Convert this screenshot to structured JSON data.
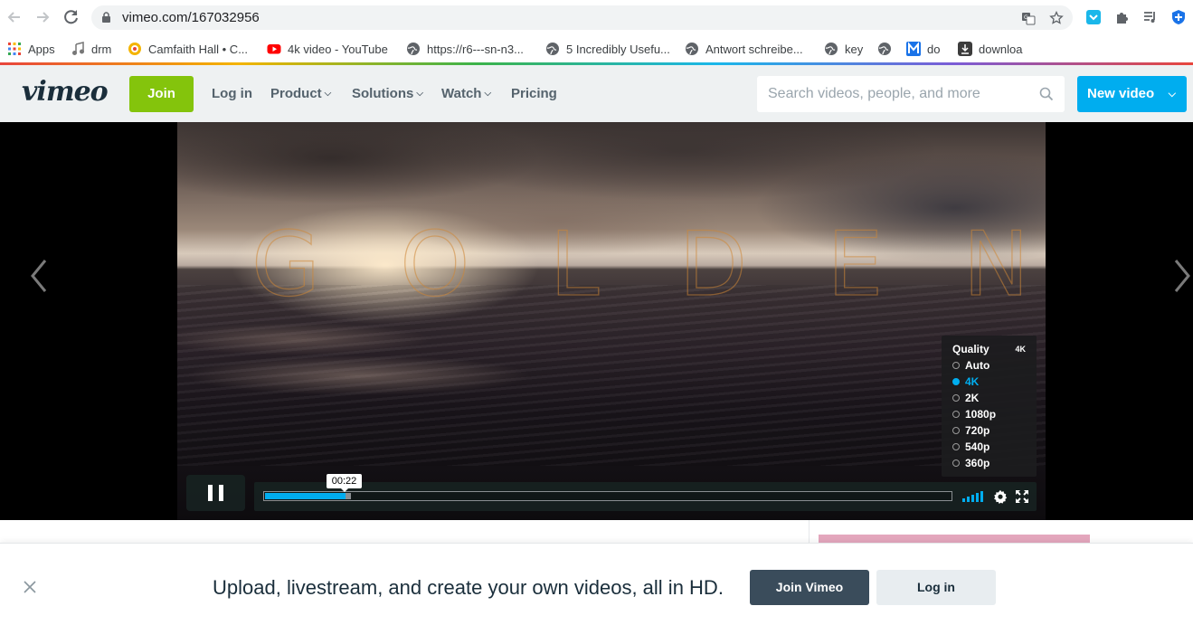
{
  "browser": {
    "url": "vimeo.com/167032956",
    "bookmarks": [
      {
        "label": "Apps",
        "icon": "apps-grid-icon"
      },
      {
        "label": "drm",
        "icon": "music-note-icon"
      },
      {
        "label": "Camfaith Hall • C...",
        "icon": "camfaith-logo-icon"
      },
      {
        "label": "4k video - YouTube",
        "icon": "youtube-icon"
      },
      {
        "label": "https://r6---sn-n3...",
        "icon": "globe-icon"
      },
      {
        "label": "5 Incredibly Usefu...",
        "icon": "globe-icon"
      },
      {
        "label": "Antwort schreibe...",
        "icon": "globe-icon"
      },
      {
        "label": "key",
        "icon": "globe-icon"
      },
      {
        "label": "",
        "icon": "globe-icon"
      },
      {
        "label": "do",
        "icon": "m-logo-icon"
      },
      {
        "label": "downloa",
        "icon": "download-app-icon"
      }
    ]
  },
  "header": {
    "logo": "vimeo",
    "join_label": "Join",
    "nav": {
      "login": "Log in",
      "product": "Product",
      "solutions": "Solutions",
      "watch": "Watch",
      "pricing": "Pricing"
    },
    "search_placeholder": "Search videos, people, and more",
    "new_video_label": "New video"
  },
  "player": {
    "title_overlay": "GOLDEN",
    "title_letters": [
      "G",
      "O",
      "L",
      "D",
      "E",
      "N"
    ],
    "time_tooltip": "00:22",
    "progress_fraction": 0.118,
    "buffer_fraction": 0.126,
    "quality": {
      "header": "Quality",
      "current": "4K",
      "options": [
        "Auto",
        "4K",
        "2K",
        "1080p",
        "720p",
        "540p",
        "360p"
      ],
      "selected": "4K"
    }
  },
  "banner": {
    "message": "Upload, livestream, and create your own videos, all in HD.",
    "join_label": "Join Vimeo",
    "login_label": "Log in"
  },
  "colors": {
    "accent_blue": "#00adef",
    "join_green": "#84c40c",
    "banner_join": "#3a4c5b",
    "ad_pink": "#e4a7bd"
  }
}
